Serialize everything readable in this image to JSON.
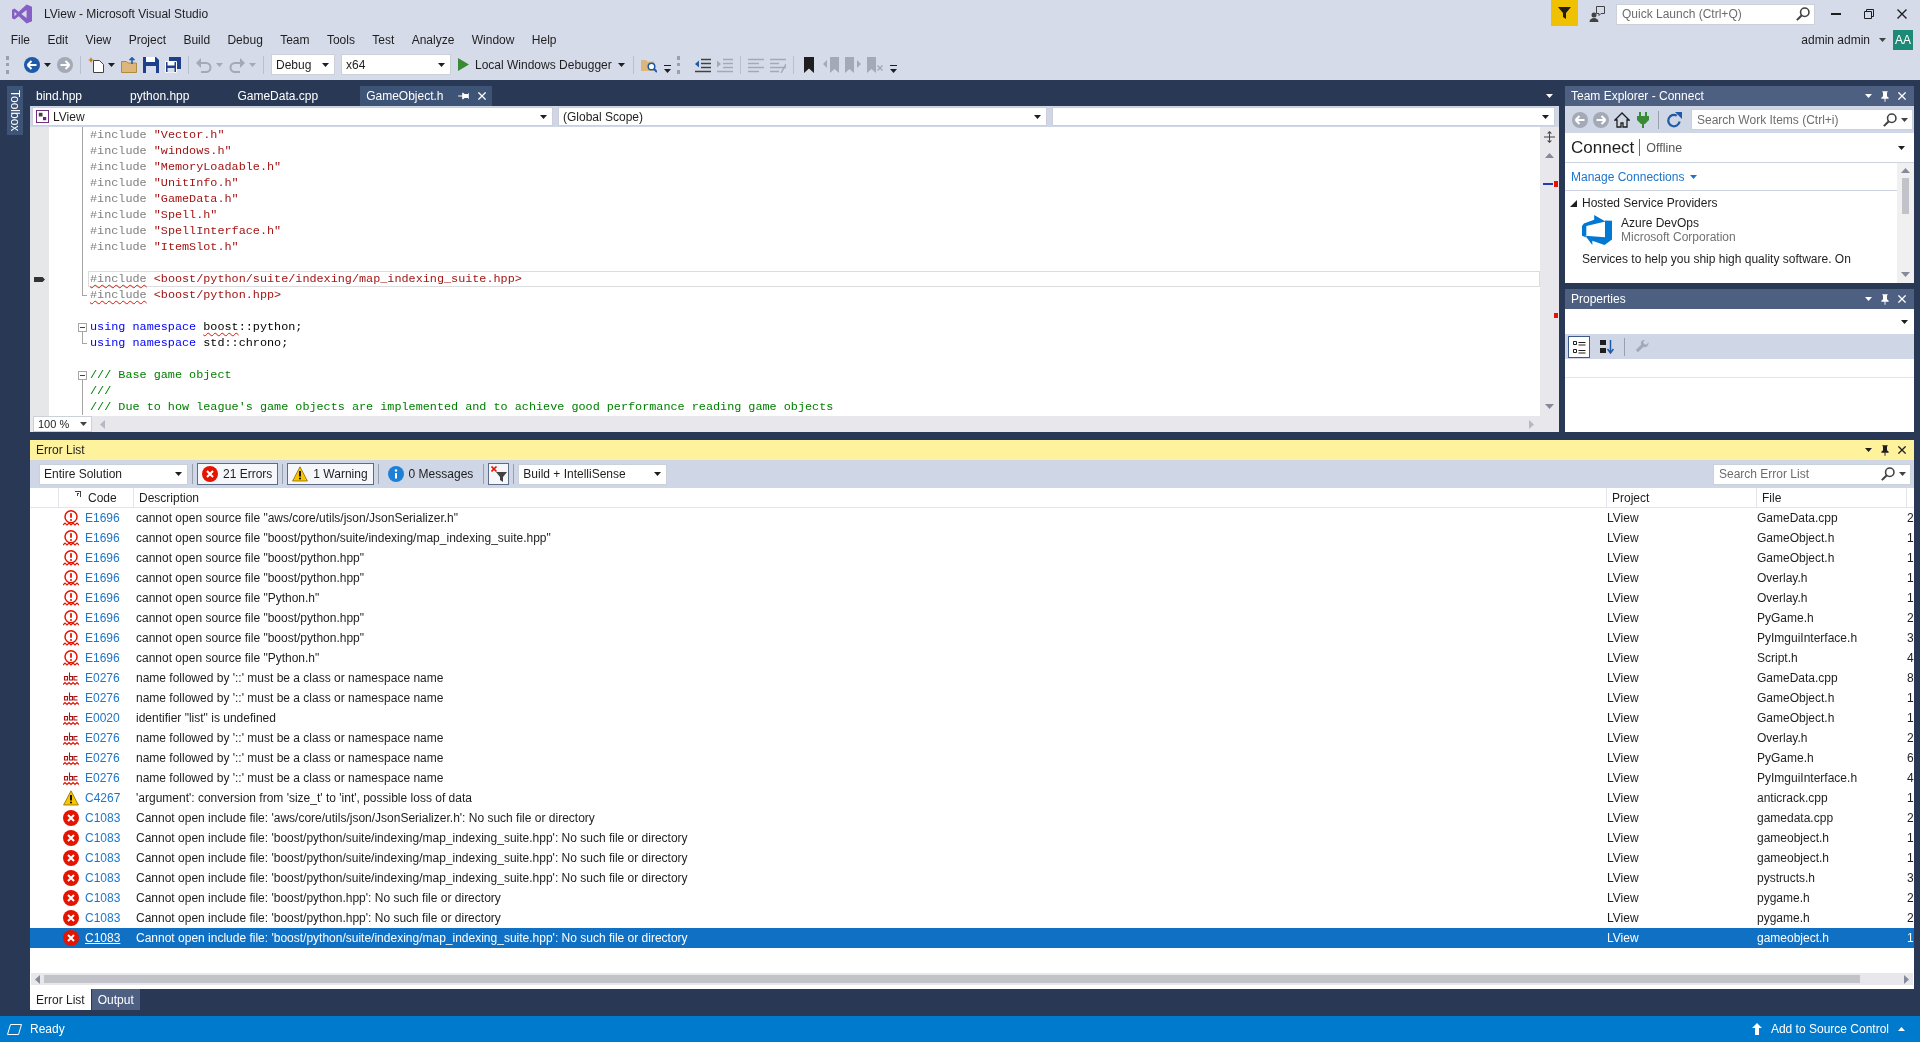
{
  "window": {
    "title": "LView - Microsoft Visual Studio",
    "quick_launch": {
      "placeholder": "Quick Launch (Ctrl+Q)"
    },
    "account": {
      "name": "admin admin",
      "initials": "AA"
    }
  },
  "menu": [
    "File",
    "Edit",
    "View",
    "Project",
    "Build",
    "Debug",
    "Team",
    "Tools",
    "Test",
    "Analyze",
    "Window",
    "Help"
  ],
  "toolbars": [
    {
      "items": [
        {
          "kind": "back",
          "disabled": false,
          "dropdown": true
        },
        {
          "kind": "forward",
          "disabled": true
        },
        {
          "kind": "separator"
        },
        {
          "kind": "new_item",
          "disabled": false,
          "dropdown": true
        },
        {
          "kind": "open",
          "disabled": false
        },
        {
          "kind": "save",
          "disabled": false
        },
        {
          "kind": "save_all",
          "disabled": false
        },
        {
          "kind": "separator"
        },
        {
          "kind": "undo",
          "disabled": true,
          "dropdown": true
        },
        {
          "kind": "redo",
          "disabled": true,
          "dropdown": true
        },
        {
          "kind": "separator"
        },
        {
          "kind": "configuration",
          "value": "Debug"
        },
        {
          "kind": "platform",
          "value": "x64"
        },
        {
          "kind": "start",
          "label": "Local Windows Debugger",
          "dropdown": true
        },
        {
          "kind": "separator"
        },
        {
          "kind": "find_files",
          "disabled": false
        }
      ]
    },
    {
      "items": [
        {
          "kind": "outdent",
          "disabled": false
        },
        {
          "kind": "indent",
          "disabled": true
        },
        {
          "kind": "separator"
        },
        {
          "kind": "comment",
          "disabled": true
        },
        {
          "kind": "uncomment",
          "disabled": true
        },
        {
          "kind": "separator"
        },
        {
          "kind": "bookmark",
          "disabled": false
        },
        {
          "kind": "prev_bookmark",
          "disabled": true
        },
        {
          "kind": "next_bookmark",
          "disabled": true
        },
        {
          "kind": "clear_bookmarks",
          "disabled": true
        }
      ]
    }
  ],
  "toolbox": {
    "label": "Toolbox"
  },
  "editor": {
    "tabs": [
      {
        "label": "bind.hpp",
        "selected": false
      },
      {
        "label": "python.hpp",
        "selected": false
      },
      {
        "label": "GameData.cpp",
        "selected": false
      },
      {
        "label": "GameObject.h",
        "selected": true
      }
    ],
    "navigation": {
      "project": "LView",
      "scope": "(Global Scope)"
    },
    "lines": [
      {
        "kind": "body",
        "current": false,
        "tokens": [
          {
            "kind": "directive",
            "text": "#include",
            "squiggle": false
          },
          {
            "kind": "string",
            "text": " \"Vector.h\"",
            "squiggle": false
          }
        ]
      },
      {
        "kind": "body",
        "current": false,
        "tokens": [
          {
            "kind": "directive",
            "text": "#include",
            "squiggle": false
          },
          {
            "kind": "string",
            "text": " \"windows.h\"",
            "squiggle": false
          }
        ]
      },
      {
        "kind": "body",
        "current": false,
        "tokens": [
          {
            "kind": "directive",
            "text": "#include",
            "squiggle": false
          },
          {
            "kind": "string",
            "text": " \"MemoryLoadable.h\"",
            "squiggle": false
          }
        ]
      },
      {
        "kind": "body",
        "current": false,
        "tokens": [
          {
            "kind": "directive",
            "text": "#include",
            "squiggle": false
          },
          {
            "kind": "string",
            "text": " \"UnitInfo.h\"",
            "squiggle": false
          }
        ]
      },
      {
        "kind": "body",
        "current": false,
        "tokens": [
          {
            "kind": "directive",
            "text": "#include",
            "squiggle": false
          },
          {
            "kind": "string",
            "text": " \"GameData.h\"",
            "squiggle": false
          }
        ]
      },
      {
        "kind": "body",
        "current": false,
        "tokens": [
          {
            "kind": "directive",
            "text": "#include",
            "squiggle": false
          },
          {
            "kind": "string",
            "text": " \"Spell.h\"",
            "squiggle": false
          }
        ]
      },
      {
        "kind": "body",
        "current": false,
        "tokens": [
          {
            "kind": "directive",
            "text": "#include",
            "squiggle": false
          },
          {
            "kind": "string",
            "text": " \"SpellInterface.h\"",
            "squiggle": false
          }
        ]
      },
      {
        "kind": "body",
        "current": false,
        "tokens": [
          {
            "kind": "directive",
            "text": "#include",
            "squiggle": false
          },
          {
            "kind": "string",
            "text": " \"ItemSlot.h\"",
            "squiggle": false
          }
        ]
      },
      {
        "kind": "body",
        "current": false
      },
      {
        "kind": "body",
        "current": true,
        "tokens": [
          {
            "kind": "directive",
            "text": "#include",
            "squiggle": true
          },
          {
            "kind": "string",
            "text": " <boost/python/suite/indexing/map_indexing_suite.hpp>",
            "squiggle": false
          }
        ]
      },
      {
        "kind": "end",
        "current": false,
        "tokens": [
          {
            "kind": "directive",
            "text": "#include",
            "squiggle": true
          },
          {
            "kind": "string",
            "text": " <boost/python.hpp>",
            "squiggle": false
          }
        ]
      },
      {
        "kind": "plain",
        "current": false
      },
      {
        "kind": "start",
        "current": false,
        "tokens": [
          {
            "kind": "keyword",
            "text": "using namespace ",
            "squiggle": false
          },
          {
            "kind": "plain",
            "text": "boost",
            "squiggle": true
          },
          {
            "kind": "plain",
            "text": "::python;",
            "squiggle": false
          }
        ]
      },
      {
        "kind": "end",
        "current": false,
        "tokens": [
          {
            "kind": "keyword",
            "text": "using namespace",
            "squiggle": false
          },
          {
            "kind": "plain",
            "text": " std::chrono;",
            "squiggle": false
          }
        ]
      },
      {
        "kind": "plain",
        "current": false
      },
      {
        "kind": "start",
        "current": false,
        "tokens": [
          {
            "kind": "comment",
            "text": "/// Base game object",
            "squiggle": false
          }
        ]
      },
      {
        "kind": "body",
        "current": false,
        "tokens": [
          {
            "kind": "comment",
            "text": "///",
            "squiggle": false
          }
        ]
      },
      {
        "kind": "body",
        "current": false,
        "tokens": [
          {
            "kind": "comment",
            "text": "/// Due to how league's game objects are implemented and to achieve good performance reading game objects",
            "squiggle": false
          }
        ]
      }
    ],
    "zoom": "100 %"
  },
  "team_explorer": {
    "title": "Team Explorer - Connect",
    "toolbar": [
      {
        "kind": "back",
        "disabled": true
      },
      {
        "kind": "forward",
        "disabled": true
      },
      {
        "kind": "home",
        "disabled": false
      },
      {
        "kind": "connect",
        "disabled": false
      },
      {
        "kind": "separator"
      },
      {
        "kind": "refresh",
        "disabled": false
      }
    ],
    "search": {
      "placeholder": "Search Work Items (Ctrl+i)"
    },
    "heading": "Connect",
    "status": "Offline",
    "link": "Manage Connections",
    "section": {
      "label": "Hosted Service Providers",
      "expanded": true,
      "providers": [
        {
          "name": "Azure DevOps",
          "publisher": "Microsoft Corporation",
          "description": "Services to help you ship high quality software. On"
        }
      ]
    }
  },
  "properties": {
    "title": "Properties",
    "tools": [
      {
        "kind": "categorized",
        "selected": true,
        "disabled": false
      },
      {
        "kind": "alphabetical",
        "selected": false,
        "disabled": false
      },
      {
        "kind": "separator"
      },
      {
        "kind": "property_pages",
        "selected": false,
        "disabled": true
      }
    ]
  },
  "error_list": {
    "title": "Error List",
    "scope": "Entire Solution",
    "filters": [
      {
        "kind": "error",
        "label": "21 Errors",
        "selected": true
      },
      {
        "kind": "warning",
        "label": "1 Warning",
        "selected": true
      },
      {
        "kind": "message",
        "label": "0 Messages",
        "selected": false
      }
    ],
    "source": "Build + IntelliSense",
    "search": {
      "placeholder": "Search Error List"
    },
    "columns": [
      "Code",
      "Description",
      "Project",
      "File"
    ],
    "rows": [
      {
        "kind": "intellisense",
        "code": "E1696",
        "description": "cannot open source file \"aws/core/utils/json/JsonSerializer.h\"",
        "project": "LView",
        "file": "GameData.cpp",
        "column_5": "2",
        "selected": false
      },
      {
        "kind": "intellisense",
        "code": "E1696",
        "description": "cannot open source file \"boost/python/suite/indexing/map_indexing_suite.hpp\"",
        "project": "LView",
        "file": "GameObject.h",
        "column_5": "1",
        "selected": false
      },
      {
        "kind": "intellisense",
        "code": "E1696",
        "description": "cannot open source file \"boost/python.hpp\"",
        "project": "LView",
        "file": "GameObject.h",
        "column_5": "1",
        "selected": false
      },
      {
        "kind": "intellisense",
        "code": "E1696",
        "description": "cannot open source file \"boost/python.hpp\"",
        "project": "LView",
        "file": "Overlay.h",
        "column_5": "1",
        "selected": false
      },
      {
        "kind": "intellisense",
        "code": "E1696",
        "description": "cannot open source file \"Python.h\"",
        "project": "LView",
        "file": "Overlay.h",
        "column_5": "1",
        "selected": false
      },
      {
        "kind": "intellisense",
        "code": "E1696",
        "description": "cannot open source file \"boost/python.hpp\"",
        "project": "LView",
        "file": "PyGame.h",
        "column_5": "2",
        "selected": false
      },
      {
        "kind": "intellisense",
        "code": "E1696",
        "description": "cannot open source file \"boost/python.hpp\"",
        "project": "LView",
        "file": "PyImguiInterface.h",
        "column_5": "3",
        "selected": false
      },
      {
        "kind": "intellisense",
        "code": "E1696",
        "description": "cannot open source file \"Python.h\"",
        "project": "LView",
        "file": "Script.h",
        "column_5": "4",
        "selected": false
      },
      {
        "kind": "syntax",
        "code": "E0276",
        "description": "name followed by '::' must be a class or namespace name",
        "project": "LView",
        "file": "GameData.cpp",
        "column_5": "8",
        "selected": false
      },
      {
        "kind": "syntax",
        "code": "E0276",
        "description": "name followed by '::' must be a class or namespace name",
        "project": "LView",
        "file": "GameObject.h",
        "column_5": "1",
        "selected": false
      },
      {
        "kind": "syntax",
        "code": "E0020",
        "description": "identifier \"list\" is undefined",
        "project": "LView",
        "file": "GameObject.h",
        "column_5": "1",
        "selected": false
      },
      {
        "kind": "syntax",
        "code": "E0276",
        "description": "name followed by '::' must be a class or namespace name",
        "project": "LView",
        "file": "Overlay.h",
        "column_5": "2",
        "selected": false
      },
      {
        "kind": "syntax",
        "code": "E0276",
        "description": "name followed by '::' must be a class or namespace name",
        "project": "LView",
        "file": "PyGame.h",
        "column_5": "6",
        "selected": false
      },
      {
        "kind": "syntax",
        "code": "E0276",
        "description": "name followed by '::' must be a class or namespace name",
        "project": "LView",
        "file": "PyImguiInterface.h",
        "column_5": "4",
        "selected": false
      },
      {
        "kind": "warning",
        "code": "C4267",
        "description": "'argument': conversion from 'size_t' to 'int', possible loss of data",
        "project": "LView",
        "file": "anticrack.cpp",
        "column_5": "1",
        "selected": false
      },
      {
        "kind": "error",
        "code": "C1083",
        "description": "Cannot open include file: 'aws/core/utils/json/JsonSerializer.h': No such file or directory",
        "project": "LView",
        "file": "gamedata.cpp",
        "column_5": "2",
        "selected": false
      },
      {
        "kind": "error",
        "code": "C1083",
        "description": "Cannot open include file: 'boost/python/suite/indexing/map_indexing_suite.hpp': No such file or directory",
        "project": "LView",
        "file": "gameobject.h",
        "column_5": "1",
        "selected": false
      },
      {
        "kind": "error",
        "code": "C1083",
        "description": "Cannot open include file: 'boost/python/suite/indexing/map_indexing_suite.hpp': No such file or directory",
        "project": "LView",
        "file": "gameobject.h",
        "column_5": "1",
        "selected": false
      },
      {
        "kind": "error",
        "code": "C1083",
        "description": "Cannot open include file: 'boost/python/suite/indexing/map_indexing_suite.hpp': No such file or directory",
        "project": "LView",
        "file": "pystructs.h",
        "column_5": "3",
        "selected": false
      },
      {
        "kind": "error",
        "code": "C1083",
        "description": "Cannot open include file: 'boost/python.hpp': No such file or directory",
        "project": "LView",
        "file": "pygame.h",
        "column_5": "2",
        "selected": false
      },
      {
        "kind": "error",
        "code": "C1083",
        "description": "Cannot open include file: 'boost/python.hpp': No such file or directory",
        "project": "LView",
        "file": "pygame.h",
        "column_5": "2",
        "selected": false
      },
      {
        "kind": "error",
        "code": "C1083",
        "description": "Cannot open include file: 'boost/python/suite/indexing/map_indexing_suite.hpp': No such file or directory",
        "project": "LView",
        "file": "gameobject.h",
        "column_5": "1",
        "selected": true
      }
    ]
  },
  "bottom_tabs": [
    {
      "label": "Error List",
      "selected": true
    },
    {
      "label": "Output",
      "selected": false
    }
  ],
  "status_bar": {
    "text": "Ready",
    "source_control": "Add to Source Control"
  }
}
